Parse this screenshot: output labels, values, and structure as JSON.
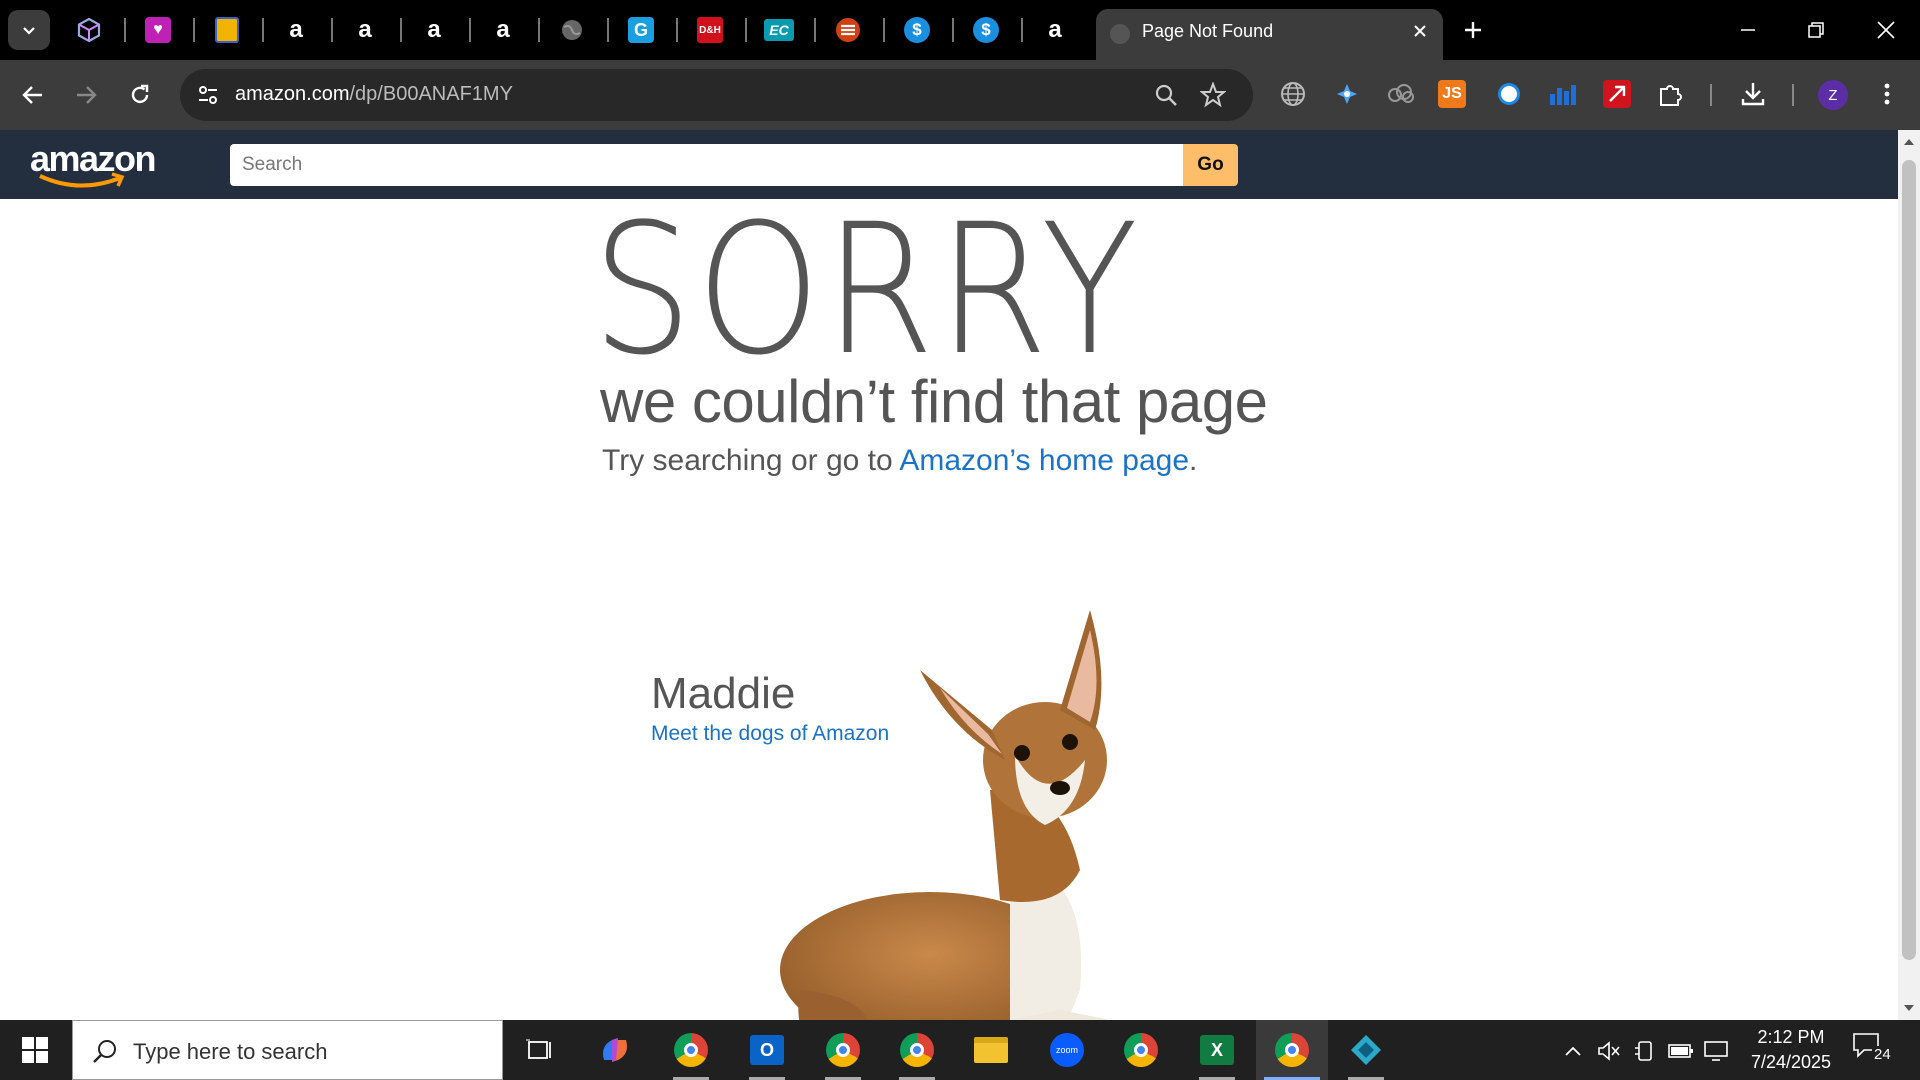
{
  "browser": {
    "active_tab": {
      "title": "Page Not Found"
    },
    "pinned_tabs": [
      {
        "icon": "cube-icon",
        "glyph": "⬡"
      },
      {
        "icon": "heart-app-icon",
        "glyph": "♥"
      },
      {
        "icon": "box-icon",
        "glyph": "▣"
      },
      {
        "icon": "amazon-icon",
        "glyph": "a"
      },
      {
        "icon": "amazon-icon",
        "glyph": "a"
      },
      {
        "icon": "amazon-icon",
        "glyph": "a"
      },
      {
        "icon": "amazon-icon",
        "glyph": "a"
      },
      {
        "icon": "globe-icon",
        "glyph": "◐"
      },
      {
        "icon": "g-app-icon",
        "glyph": "G"
      },
      {
        "icon": "dh-icon",
        "glyph": "D"
      },
      {
        "icon": "ec-icon",
        "glyph": "EC"
      },
      {
        "icon": "stack-icon",
        "glyph": "≡"
      },
      {
        "icon": "dollar-icon",
        "glyph": "$"
      },
      {
        "icon": "dollar-icon",
        "glyph": "$"
      },
      {
        "icon": "amazon-icon",
        "glyph": "a"
      }
    ],
    "url_host": "amazon.com",
    "url_path": "/dp/B00ANAF1MY",
    "extensions": [
      {
        "icon": "globe-extension-icon"
      },
      {
        "icon": "plus-extension-icon"
      },
      {
        "icon": "cloud-extension-icon"
      },
      {
        "icon": "js-extension-icon",
        "label": "JS"
      },
      {
        "icon": "circle-extension-icon"
      },
      {
        "icon": "chart-extension-icon"
      },
      {
        "icon": "arrow-extension-icon"
      },
      {
        "icon": "puzzle-icon"
      }
    ],
    "profile_initial": "Z"
  },
  "page": {
    "search_placeholder": "Search",
    "go_label": "Go",
    "sorry": "SORRY",
    "subheading": "we couldn’t find that page",
    "try_prefix": "Try searching or go to ",
    "home_link": "Amazon’s home page",
    "try_suffix": ".",
    "dog_name": "Maddie",
    "dog_link": "Meet the dogs of Amazon",
    "logo_text": "amazon"
  },
  "taskbar": {
    "search_placeholder": "Type here to search",
    "time": "2:12 PM",
    "date": "7/24/2025",
    "notification_count": "24",
    "apps": [
      {
        "name": "task-view-icon"
      },
      {
        "name": "copilot-icon"
      },
      {
        "name": "chrome-profile-icon"
      },
      {
        "name": "outlook-icon"
      },
      {
        "name": "chrome-profile-icon"
      },
      {
        "name": "chrome-profile-icon"
      },
      {
        "name": "file-explorer-icon"
      },
      {
        "name": "zoom-icon"
      },
      {
        "name": "chrome-icon"
      },
      {
        "name": "excel-icon"
      },
      {
        "name": "chrome-profile-icon"
      },
      {
        "name": "diamond-app-icon"
      }
    ]
  },
  "colors": {
    "amazon_nav": "#232f3e",
    "go_button": "#febd69",
    "link": "#1a73c8",
    "tab_bg": "#3c3c3c"
  }
}
